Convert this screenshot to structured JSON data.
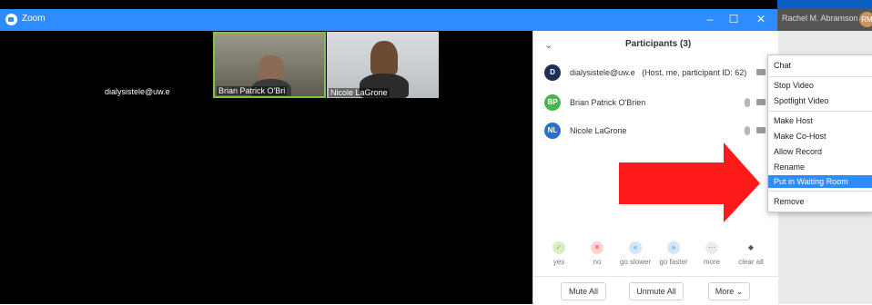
{
  "window": {
    "title": "Zoom",
    "minimize": "–",
    "maximize": "☐",
    "close": "✕"
  },
  "user": {
    "name": "Rachel M. Abramson",
    "initials": "RM"
  },
  "video": {
    "self_label": "dialysistele@uw.e",
    "tiles": [
      {
        "label": "Brian Patrick O'Bri"
      },
      {
        "label": "Nicole LaGrone"
      }
    ]
  },
  "participants": {
    "title": "Participants (3)",
    "items": [
      {
        "initials": "D",
        "name": "dialysistele@uw.e",
        "note": "(Host, me, participant ID: 62)",
        "color": "#1f2d5a"
      },
      {
        "initials": "BP",
        "name": "Brian Patrick O'Brien",
        "note": "",
        "color": "#49b84a"
      },
      {
        "initials": "NL",
        "name": "Nicole LaGrone",
        "note": "",
        "color": "#2b6fc7"
      }
    ],
    "reactions": [
      {
        "icon": "✓",
        "label": "yes",
        "color": "#7dc344"
      },
      {
        "icon": "✕",
        "label": "no",
        "color": "#e8423f"
      },
      {
        "icon": "«",
        "label": "go slower",
        "color": "#3b8ee8"
      },
      {
        "icon": "»",
        "label": "go faster",
        "color": "#3b8ee8"
      },
      {
        "icon": "···",
        "label": "more",
        "color": "#777777"
      },
      {
        "icon": "◆",
        "label": "clear all",
        "color": "#555555"
      }
    ],
    "footer": {
      "mute_all": "Mute All",
      "unmute_all": "Unmute All",
      "more": "More ⌄"
    }
  },
  "context_menu": {
    "items": [
      "Chat",
      "Stop Video",
      "Spotlight Video",
      "Make Host",
      "Make Co-Host",
      "Allow Record",
      "Rename",
      "Put in Waiting Room",
      "Remove"
    ],
    "selected": "Put in Waiting Room"
  },
  "colors": {
    "accent": "#2d8cff",
    "arrow": "#ff1a1a"
  }
}
